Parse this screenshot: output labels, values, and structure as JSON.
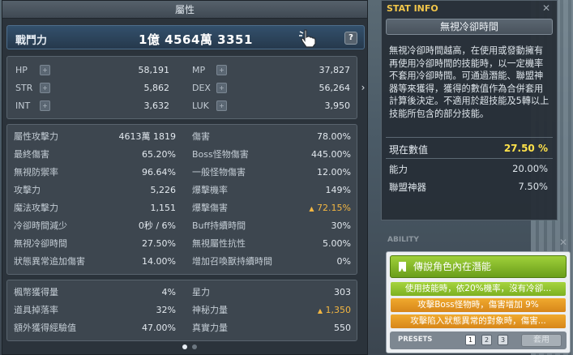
{
  "main": {
    "title": "屬性",
    "power_label": "戰鬥力",
    "power_value": "1億 4564萬 3351",
    "help_label": "?"
  },
  "basic_stats": [
    {
      "label": "HP",
      "value": "58,191"
    },
    {
      "label": "MP",
      "value": "37,827"
    },
    {
      "label": "STR",
      "value": "5,862"
    },
    {
      "label": "DEX",
      "value": "56,264"
    },
    {
      "label": "INT",
      "value": "3,632"
    },
    {
      "label": "LUK",
      "value": "3,950"
    }
  ],
  "detail_stats": [
    {
      "left_label": "屬性攻擊力",
      "left_value": "4613萬 1819",
      "right_label": "傷害",
      "right_value": "78.00%"
    },
    {
      "left_label": "最終傷害",
      "left_value": "65.20%",
      "right_label": "Boss怪物傷害",
      "right_value": "445.00%"
    },
    {
      "left_label": "無視防禦率",
      "left_value": "96.64%",
      "right_label": "一般怪物傷害",
      "right_value": "12.00%"
    },
    {
      "left_label": "攻擊力",
      "left_value": "5,226",
      "right_label": "爆擊機率",
      "right_value": "149%"
    },
    {
      "left_label": "魔法攻擊力",
      "left_value": "1,151",
      "right_label": "爆擊傷害",
      "right_value": "72.15%"
    },
    {
      "left_label": "冷卻時間減少",
      "left_value": "0秒 / 6%",
      "right_label": "Buff持續時間",
      "right_value": "30%"
    },
    {
      "left_label": "無視冷卻時間",
      "left_value": "27.50%",
      "right_label": "無視屬性抗性",
      "right_value": "5.00%"
    },
    {
      "left_label": "狀態異常追加傷害",
      "left_value": "14.00%",
      "right_label": "增加召喚獸持續時間",
      "right_value": "0%"
    }
  ],
  "extra_stats": [
    {
      "left_label": "楓幣獲得量",
      "left_value": "4%",
      "right_label": "星力",
      "right_value": "303"
    },
    {
      "left_label": "道具掉落率",
      "left_value": "32%",
      "right_label": "神秘力量",
      "right_value": "1,350"
    },
    {
      "left_label": "額外獲得經驗值",
      "left_value": "47.00%",
      "right_label": "真實力量",
      "right_value": "550"
    }
  ],
  "stat_info": {
    "title": "STAT INFO",
    "stat_name": "無視冷卻時間",
    "description": "無視冷卻時間越高，在使用或發動擁有再使用冷卻時間的技能時，以一定機率不套用冷卻時間。可通過潛能、聯盟神器等來獲得，獲得的數值作為合併套用計算後決定。不適用於超技能及5轉以上技能所包含的部分技能。",
    "current_label": "現在數值",
    "current_value": "27.50 %",
    "sources": [
      {
        "label": "能力",
        "value": "20.00%"
      },
      {
        "label": "聯盟神器",
        "value": "7.50%"
      }
    ]
  },
  "ability": {
    "tag": "ABILITY",
    "header": "傳說角色內在潛能",
    "lines": [
      "使用技能時，依20%機率，沒有冷卻...",
      "攻擊Boss怪物時，傷害增加 9%",
      "攻擊陷入狀態異常的對象時，傷害..."
    ],
    "presets_label": "PRESETS",
    "preset_buttons": [
      "1",
      "2",
      "3"
    ],
    "apply_label": "套用"
  },
  "colors": {
    "accent_yellow": "#ffe24a",
    "increase_orange": "#f2b642",
    "ability_green": "#7cb021",
    "ability_orange": "#d7861a"
  }
}
